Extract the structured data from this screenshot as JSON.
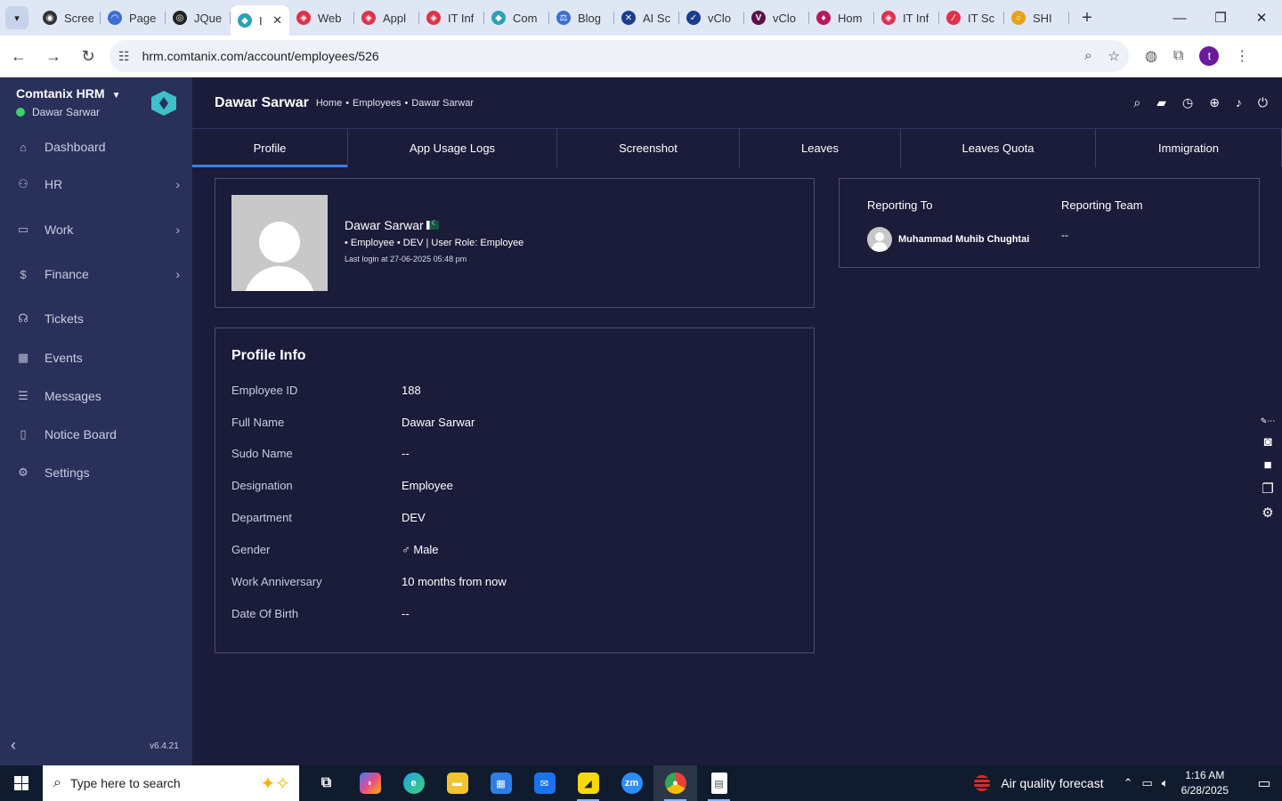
{
  "browser": {
    "tabs": [
      {
        "title": "Scree",
        "color": "#333333",
        "glyph": "◉",
        "active": false
      },
      {
        "title": "Page",
        "color": "#3b6fd1",
        "glyph": "◠",
        "active": false
      },
      {
        "title": "JQue",
        "color": "#222222",
        "glyph": "◎",
        "active": false
      },
      {
        "title": "I",
        "color": "#2aa1b5",
        "glyph": "◆",
        "active": true
      },
      {
        "title": "Web",
        "color": "#e0324b",
        "glyph": "◈",
        "active": false
      },
      {
        "title": "Appl",
        "color": "#e0324b",
        "glyph": "◈",
        "active": false
      },
      {
        "title": "IT Inf",
        "color": "#e0324b",
        "glyph": "◈",
        "active": false
      },
      {
        "title": "Com",
        "color": "#2aa1b5",
        "glyph": "◆",
        "active": false
      },
      {
        "title": "Blog",
        "color": "#3b6fd1",
        "glyph": "⚖",
        "active": false
      },
      {
        "title": "AI Sc",
        "color": "#1a3e8c",
        "glyph": "✕",
        "active": false
      },
      {
        "title": "vClo",
        "color": "#1a3e8c",
        "glyph": "✓",
        "active": false
      },
      {
        "title": "vClo",
        "color": "#5a0f4a",
        "glyph": "V",
        "active": false
      },
      {
        "title": "Hom",
        "color": "#b51a5a",
        "glyph": "♦",
        "active": false
      },
      {
        "title": "IT Inf",
        "color": "#e0324b",
        "glyph": "◈",
        "active": false
      },
      {
        "title": "IT Sc",
        "color": "#e0324b",
        "glyph": "∕",
        "active": false
      },
      {
        "title": "SHI",
        "color": "#e8a21a",
        "glyph": "○",
        "active": false
      }
    ],
    "url": "hrm.comtanix.com/account/employees/526",
    "profile_initial": "t"
  },
  "sidebar": {
    "brand": "Comtanix HRM",
    "user": "Dawar Sarwar",
    "version": "v6.4.21",
    "items": [
      {
        "label": "Dashboard",
        "icon": "⌂",
        "name": "dashboard",
        "top": 0,
        "chevron": false
      },
      {
        "label": "HR",
        "icon": "⚇",
        "name": "hr",
        "chevron": true
      },
      {
        "label": "Work",
        "icon": "▭",
        "name": "work",
        "chevron": true
      },
      {
        "label": "Finance",
        "icon": "$",
        "name": "finance",
        "chevron": true
      },
      {
        "label": "Tickets",
        "icon": "☊",
        "name": "tickets",
        "chevron": false
      },
      {
        "label": "Events",
        "icon": "▦",
        "name": "events",
        "chevron": false
      },
      {
        "label": "Messages",
        "icon": "☰",
        "name": "messages",
        "chevron": false
      },
      {
        "label": "Notice Board",
        "icon": "▯",
        "name": "notice-board",
        "chevron": false
      },
      {
        "label": "Settings",
        "icon": "⚙",
        "name": "settings",
        "chevron": false
      }
    ]
  },
  "header": {
    "title": "Dawar Sarwar",
    "breadcrumb": [
      "Home",
      "•",
      "Employees",
      "•",
      "Dawar Sarwar"
    ]
  },
  "tabs": [
    {
      "label": "Profile",
      "active": true
    },
    {
      "label": "App Usage Logs",
      "active": false
    },
    {
      "label": "Screenshot",
      "active": false
    },
    {
      "label": "Leaves",
      "active": false
    },
    {
      "label": "Leaves Quota",
      "active": false
    },
    {
      "label": "Immigration",
      "active": false
    }
  ],
  "profile": {
    "name": "Dawar Sarwar",
    "meta": "• Employee • DEV   | User Role: Employee",
    "last_login": "Last login at 27-06-2025 05:48 pm"
  },
  "reporting": {
    "to_label": "Reporting To",
    "team_label": "Reporting Team",
    "to_person": "Muhammad Muhib Chughtai",
    "team_value": "--"
  },
  "profile_info": {
    "title": "Profile Info",
    "rows": [
      {
        "label": "Employee ID",
        "value": "188"
      },
      {
        "label": "Full Name",
        "value": "Dawar Sarwar"
      },
      {
        "label": "Sudo Name",
        "value": "--"
      },
      {
        "label": "Designation",
        "value": "Employee"
      },
      {
        "label": "Department",
        "value": "DEV"
      },
      {
        "label": "Gender",
        "value": "♂ Male"
      },
      {
        "label": "Work Anniversary",
        "value": "10 months from now"
      },
      {
        "label": "Date Of Birth",
        "value": "--"
      }
    ]
  },
  "taskbar": {
    "search_placeholder": "Type here to search",
    "weather": "Air quality forecast",
    "time": "1:16 AM",
    "date": "6/28/2025"
  }
}
